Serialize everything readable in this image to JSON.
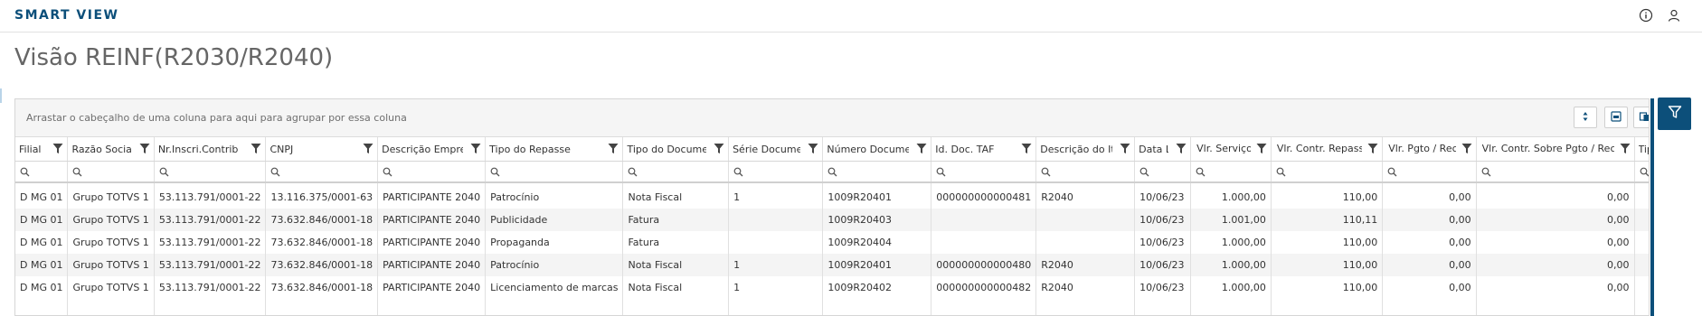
{
  "app": {
    "brand": "SMART VIEW"
  },
  "icons": {
    "info": "info-icon",
    "user": "user-icon",
    "filter": "filter-icon",
    "search": "search-icon",
    "sort": "sort-arrows-icon",
    "export": "export-icon",
    "copy": "copy-icon"
  },
  "colors": {
    "brand": "#0c4f7a",
    "accent_bar": "#0c4f7a"
  },
  "page": {
    "title": "Visão REINF(R2030/R2040)"
  },
  "grid": {
    "group_hint": "Arrastar o cabeçalho de uma coluna para aqui para agrupar por essa coluna",
    "columns": [
      "Filial",
      "Razão Social",
      "Nr.Inscri.Contrib",
      "CNPJ",
      "Descrição Empresa",
      "Tipo do Repasse",
      "Tipo do Documento",
      "Série Documento",
      "Número Documento",
      "Id. Doc. TAF",
      "Descrição do Item",
      "Data Lcto",
      "Vlr. Serviço",
      "Vlr. Contr. Repass",
      "Vlr. Pgto / Rec",
      "Vlr. Contr. Sobre Pgto / Rec",
      "Tipo do"
    ],
    "rows": [
      [
        "D MG 01",
        "Grupo TOTVS 1",
        "53.113.791/0001-22",
        "13.116.375/0001-63",
        "PARTICIPANTE 2040",
        "Patrocínio",
        "Nota Fiscal",
        "1",
        "1009R20401",
        "000000000000481",
        "R2040",
        "10/06/23",
        "1.000,00",
        "110,00",
        "0,00",
        "0,00",
        ""
      ],
      [
        "D MG 01",
        "Grupo TOTVS 1",
        "53.113.791/0001-22",
        "73.632.846/0001-18",
        "PARTICIPANTE 2040",
        "Publicidade",
        "Fatura",
        "",
        "1009R20403",
        "",
        "",
        "10/06/23",
        "1.001,00",
        "110,11",
        "0,00",
        "0,00",
        ""
      ],
      [
        "D MG 01",
        "Grupo TOTVS 1",
        "53.113.791/0001-22",
        "73.632.846/0001-18",
        "PARTICIPANTE 2040",
        "Propaganda",
        "Fatura",
        "",
        "1009R20404",
        "",
        "",
        "10/06/23",
        "1.000,00",
        "110,00",
        "0,00",
        "0,00",
        ""
      ],
      [
        "D MG 01",
        "Grupo TOTVS 1",
        "53.113.791/0001-22",
        "73.632.846/0001-18",
        "PARTICIPANTE 2040",
        "Patrocínio",
        "Nota Fiscal",
        "1",
        "1009R20401",
        "000000000000480",
        "R2040",
        "10/06/23",
        "1.000,00",
        "110,00",
        "0,00",
        "0,00",
        ""
      ],
      [
        "D MG 01",
        "Grupo TOTVS 1",
        "53.113.791/0001-22",
        "73.632.846/0001-18",
        "PARTICIPANTE 2040",
        "Licenciamento de marcas",
        "Nota Fiscal",
        "1",
        "1009R20402",
        "000000000000482",
        "R2040",
        "10/06/23",
        "1.000,00",
        "110,00",
        "0,00",
        "0,00",
        ""
      ]
    ]
  }
}
